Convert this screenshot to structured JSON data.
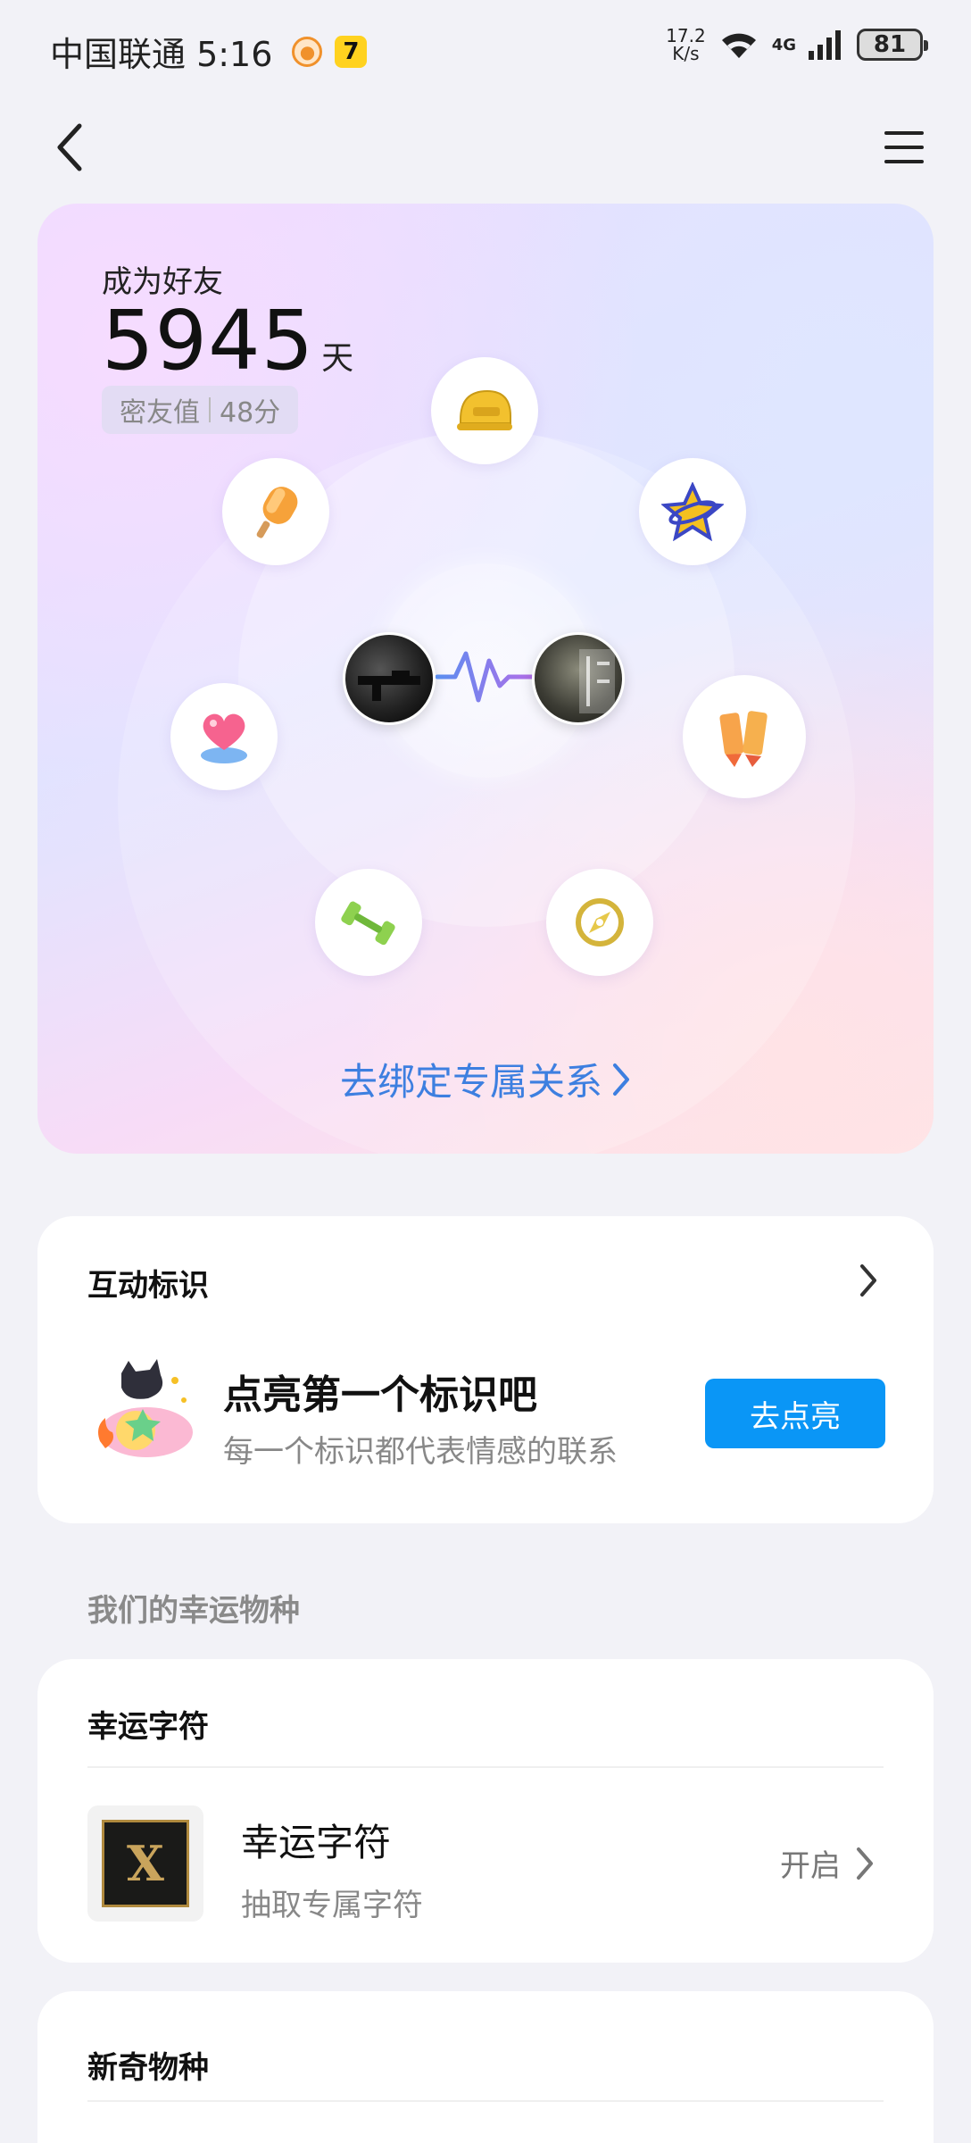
{
  "status_bar": {
    "carrier_time": "中国联通 5:16",
    "net_speed_value": "17.2",
    "net_speed_unit": "K/s",
    "network_type": "4G",
    "battery": "81"
  },
  "hero": {
    "friend_label": "成为好友",
    "days": "5945",
    "days_unit": "天",
    "intimacy_label": "密友值",
    "intimacy_value": "48分",
    "bind_link": "去绑定专属关系"
  },
  "interaction": {
    "title": "互动标识",
    "headline": "点亮第一个标识吧",
    "subtitle": "每一个标识都代表情感的联系",
    "button": "去点亮"
  },
  "lucky_section_label": "我们的幸运物种",
  "lucky_char": {
    "title": "幸运字符",
    "item_name": "幸运字符",
    "item_sub": "抽取专属字符",
    "item_state": "开启",
    "thumb_letter": "X"
  },
  "novel": {
    "title": "新奇物种"
  },
  "icons": [
    "back-arrow-icon",
    "menu-icon",
    "helmet-icon",
    "popsicle-icon",
    "star-icon",
    "heart-icon",
    "crayons-icon",
    "dumbbell-icon",
    "compass-icon",
    "chevron-right-icon"
  ],
  "colors": {
    "accent": "#0a96f6",
    "link": "#3d7fe0",
    "background": "#f2f2f7"
  }
}
